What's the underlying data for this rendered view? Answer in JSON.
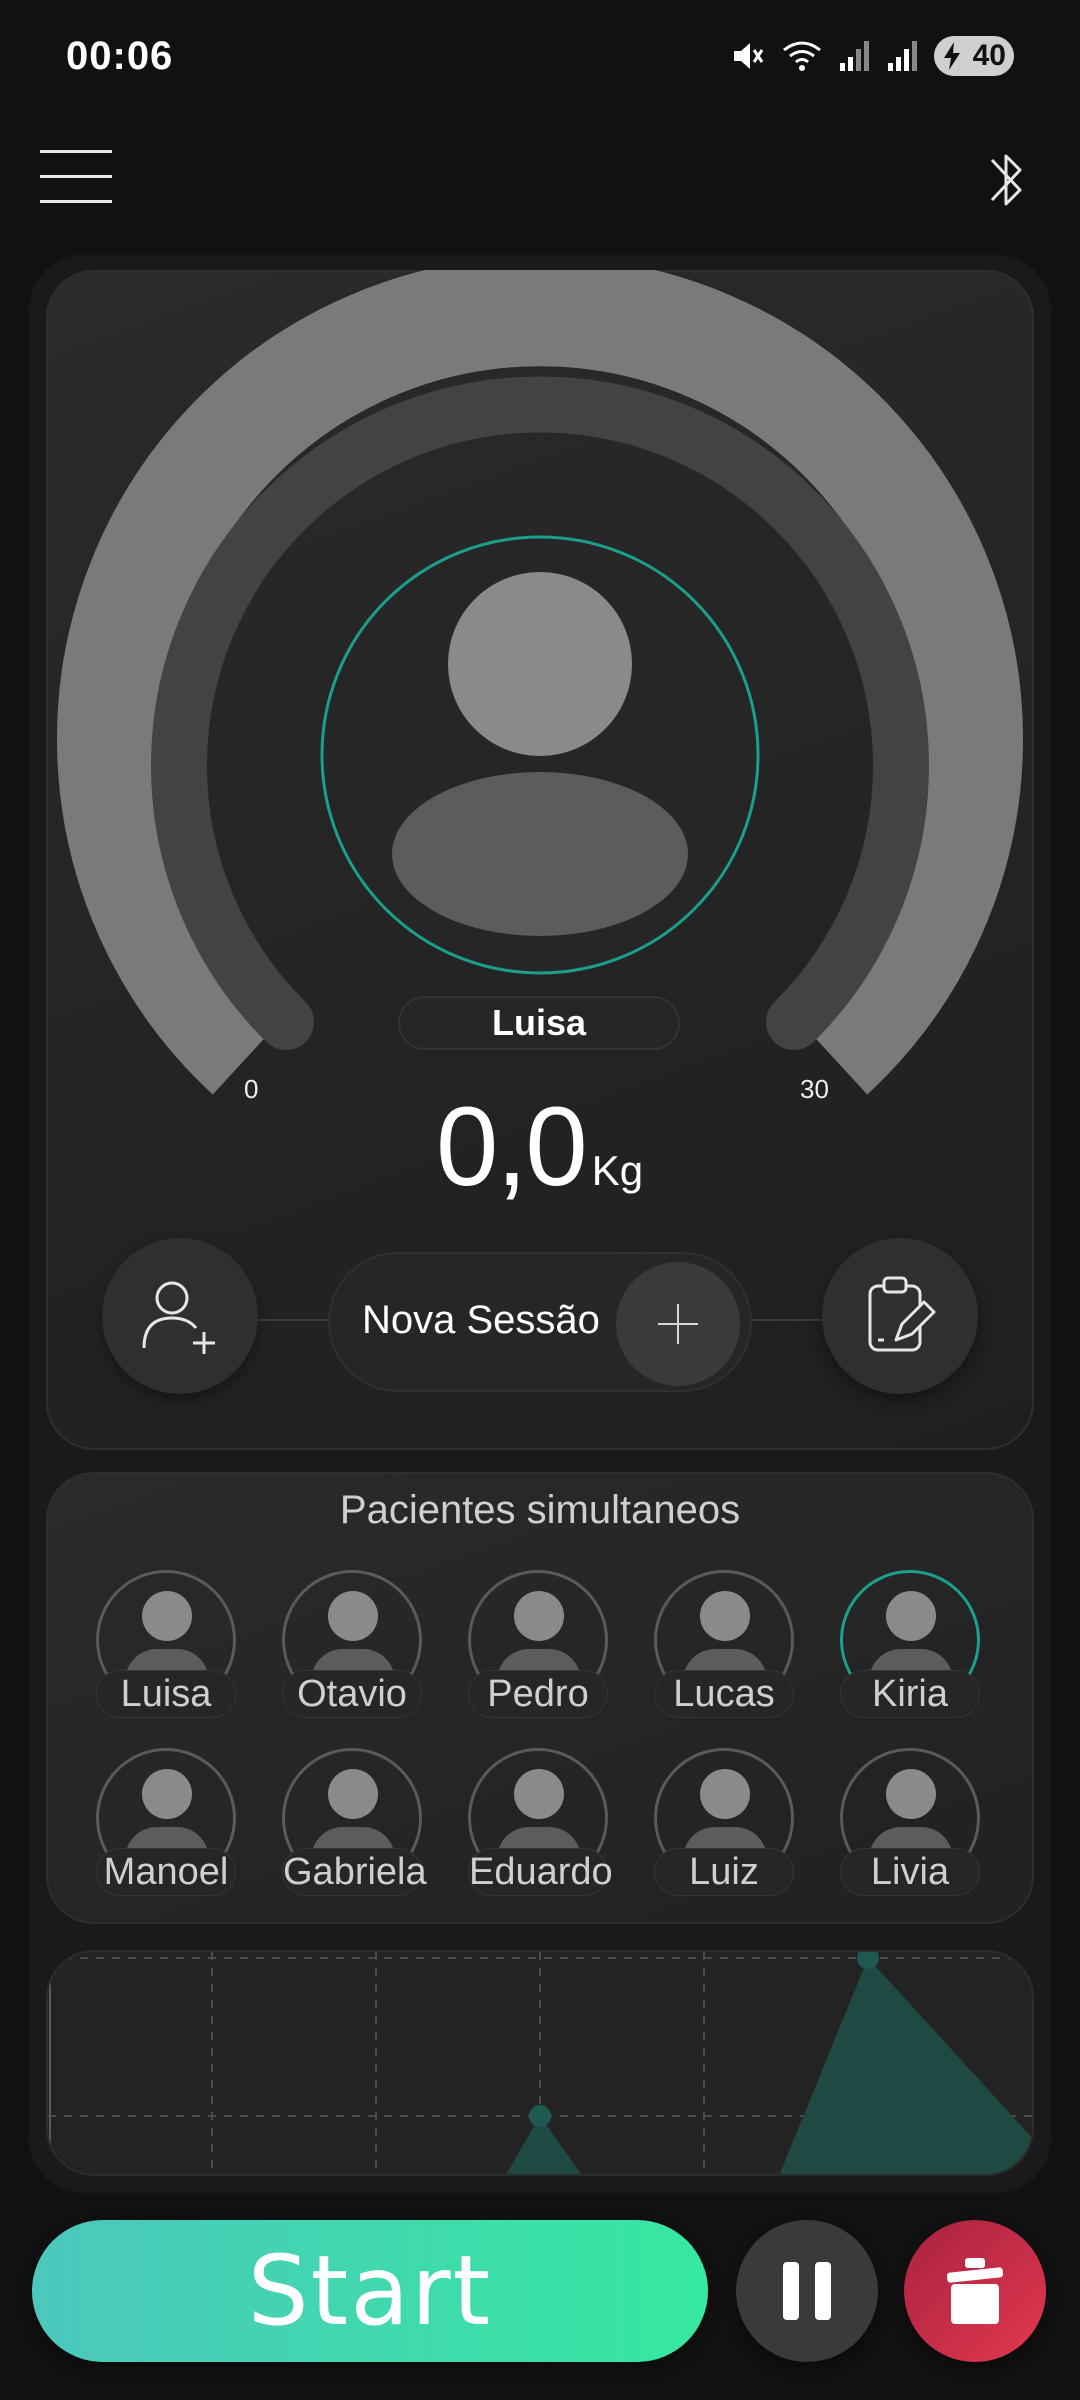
{
  "status_bar": {
    "time": "00:06",
    "battery": "40",
    "wifi_label": "5"
  },
  "icons": {
    "menu": "hamburger-menu-icon",
    "bluetooth": "bluetooth-icon",
    "add_user": "add-user-icon",
    "add": "plus-icon",
    "clipboard": "clipboard-edit-icon",
    "pause": "pause-icon",
    "trash": "trash-icon",
    "avatar": "user-avatar-icon"
  },
  "gauge": {
    "min_label": "0",
    "max_label": "30",
    "current_value": 0,
    "current_patient": "Luisa"
  },
  "weight": {
    "value": "0,0",
    "unit": "Kg"
  },
  "session": {
    "label": "Nova Sessão"
  },
  "patients": {
    "title": "Pacientes simultaneos",
    "names": [
      "Luisa",
      "Otavio",
      "Pedro",
      "Lucas",
      "Kiria",
      "Manoel",
      "Gabriela",
      "Eduardo",
      "Luiz",
      "Livia"
    ],
    "active": "Kiria"
  },
  "controls": {
    "start": "Start"
  },
  "colors": {
    "accent": "#1b9e8c",
    "start_from": "#4cc7bd",
    "start_to": "#36e8a0",
    "trash": "#e2384f",
    "background": "#111111"
  }
}
